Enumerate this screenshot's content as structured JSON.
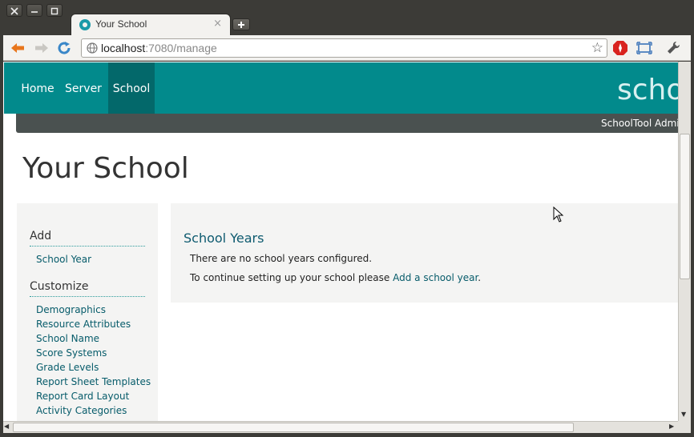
{
  "browser": {
    "tab_title": "Your School",
    "tab_close": "×",
    "url_host": "localhost",
    "url_rest": ":7080/manage",
    "star": "☆"
  },
  "nav": {
    "home": "Home",
    "server": "Server",
    "school": "School",
    "brand": "schoo"
  },
  "subbar": {
    "user": "SchoolTool Admin"
  },
  "page": {
    "title": "Your School"
  },
  "sidebar": {
    "add_heading": "Add",
    "add_items": [
      "School Year"
    ],
    "customize_heading": "Customize",
    "customize_items": [
      "Demographics",
      "Resource Attributes",
      "School Name",
      "Score Systems",
      "Grade Levels",
      "Report Sheet Templates",
      "Report Card Layout",
      "Activity Categories"
    ]
  },
  "main": {
    "title": "School Years",
    "message1": "There are no school years configured.",
    "message2_prefix": "To continue setting up your school please ",
    "message2_link": "Add a school year",
    "message2_suffix": "."
  },
  "colors": {
    "nav_bg": "#028a8c",
    "nav_active": "#03686a",
    "link": "#065b6a"
  }
}
